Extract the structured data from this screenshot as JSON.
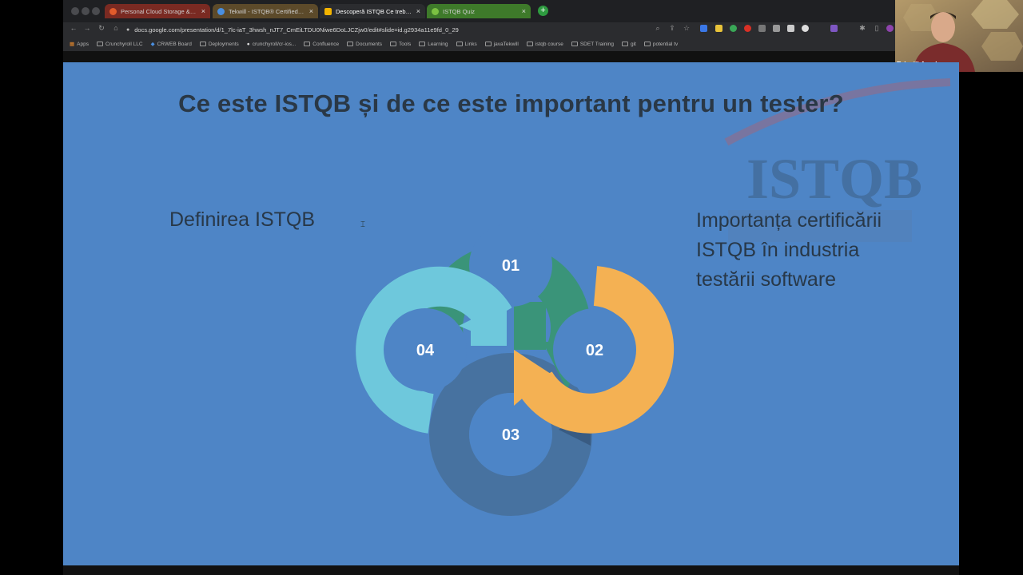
{
  "browser": {
    "tabs": [
      {
        "label": "Personal Cloud Storage & File",
        "favicon_color": "#e25b2b"
      },
      {
        "label": "Tekwill - ISTQB® Certified Te",
        "favicon_color": "#4a8fe0"
      },
      {
        "label": "Descoperă ISTQB Ce trebuie s",
        "favicon_color": "#f4b400"
      },
      {
        "label": "ISTQB Quiz",
        "favicon_color": "#7bc142"
      }
    ],
    "close_glyph": "×",
    "new_tab_glyph": "+",
    "url": "docs.google.com/presentation/d/1_7lc-iaT_3hwsh_nJT7_CmEiLTDU0Niwe6DoLJCZjw0/edit#slide=id.g2934a11e9fd_0_29",
    "bookmarks": [
      "Apps",
      "Crunchyroll LLC",
      "CRWEB Board",
      "Deployments",
      "crunchyroll/cr-ios...",
      "Confluence",
      "Documents",
      "Tools",
      "Learning",
      "Links",
      "javaTekwill",
      "istqb course",
      "SDET Training",
      "git",
      "potential tv"
    ]
  },
  "webcam": {
    "name": "Tekwill Academy"
  },
  "slide": {
    "title": "Ce este ISTQB și de ce este important pentru un tester?",
    "left_text": "Definirea ISTQB",
    "right_text_lines": [
      "Importanța certificării",
      "ISTQB în industria",
      "testării software"
    ],
    "watermark": "ISTQB",
    "cycle": [
      {
        "label": "01",
        "color": "#3a9479"
      },
      {
        "label": "02",
        "color": "#f4b153"
      },
      {
        "label": "03",
        "color": "#466f99"
      },
      {
        "label": "04",
        "color": "#6ec8dc"
      }
    ]
  },
  "colors": {
    "slide_bg": "#4e85c6",
    "title_color": "#2a3846"
  }
}
